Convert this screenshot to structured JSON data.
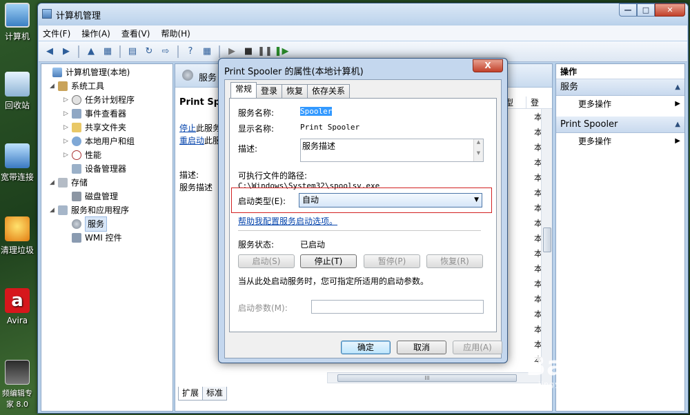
{
  "desktop": {
    "icons": [
      {
        "label": "计算机"
      },
      {
        "label": "回收站"
      },
      {
        "label": "宽带连接"
      },
      {
        "label": "清理垃圾"
      },
      {
        "label": "Avira"
      },
      {
        "label": "频编辑专家 8.0"
      }
    ]
  },
  "window": {
    "title": "计算机管理",
    "menu": [
      "文件(F)",
      "操作(A)",
      "查看(V)",
      "帮助(H)"
    ]
  },
  "tree": {
    "root": "计算机管理(本地)",
    "system_tools": "系统工具",
    "task_scheduler": "任务计划程序",
    "event_viewer": "事件查看器",
    "shared_folders": "共享文件夹",
    "local_users": "本地用户和组",
    "performance": "性能",
    "device_manager": "设备管理器",
    "storage": "存储",
    "disk_mgmt": "磁盘管理",
    "services_apps": "服务和应用程序",
    "services": "服务",
    "wmi": "WMI 控件"
  },
  "center": {
    "header": "服务",
    "service_name": "Print Spo",
    "stop_link": "停止",
    "stop_suffix": "此服务",
    "restart_link": "重启动",
    "restart_suffix": "此服",
    "desc_label": "描述:",
    "desc_value": "服务描述",
    "col_partial": "型",
    "col_partial2": "登",
    "cell_value": "本",
    "bottom_tabs": [
      "扩展",
      "标准"
    ]
  },
  "actions": {
    "title": "操作",
    "section1": "服务",
    "more1": "更多操作",
    "section2": "Print Spooler",
    "more2": "更多操作"
  },
  "dialog": {
    "title": "Print Spooler 的属性(本地计算机)",
    "close": "X",
    "tabs": [
      "常规",
      "登录",
      "恢复",
      "依存关系"
    ],
    "service_name_label": "服务名称:",
    "service_name_value": "Spooler",
    "display_name_label": "显示名称:",
    "display_name_value": "Print Spooler",
    "desc_label": "描述:",
    "desc_value": "服务描述",
    "path_label": "可执行文件的路径:",
    "path_value": "C:\\Windows\\System32\\spoolsv.exe",
    "startup_type_label": "启动类型(E):",
    "startup_type_value": "自动",
    "help_link": "帮助我配置服务启动选项。",
    "status_label": "服务状态:",
    "status_value": "已启动",
    "btn_start": "启动(S)",
    "btn_stop": "停止(T)",
    "btn_pause": "暂停(P)",
    "btn_resume": "恢复(R)",
    "param_hint": "当从此处启动服务时，您可指定所适用的启动参数。",
    "param_label": "启动参数(M):",
    "btn_ok": "确定",
    "btn_cancel": "取消",
    "btn_apply": "应用(A)"
  },
  "watermark": {
    "text": "Bai 经验",
    "sub": "jingyan.baidu.com"
  }
}
